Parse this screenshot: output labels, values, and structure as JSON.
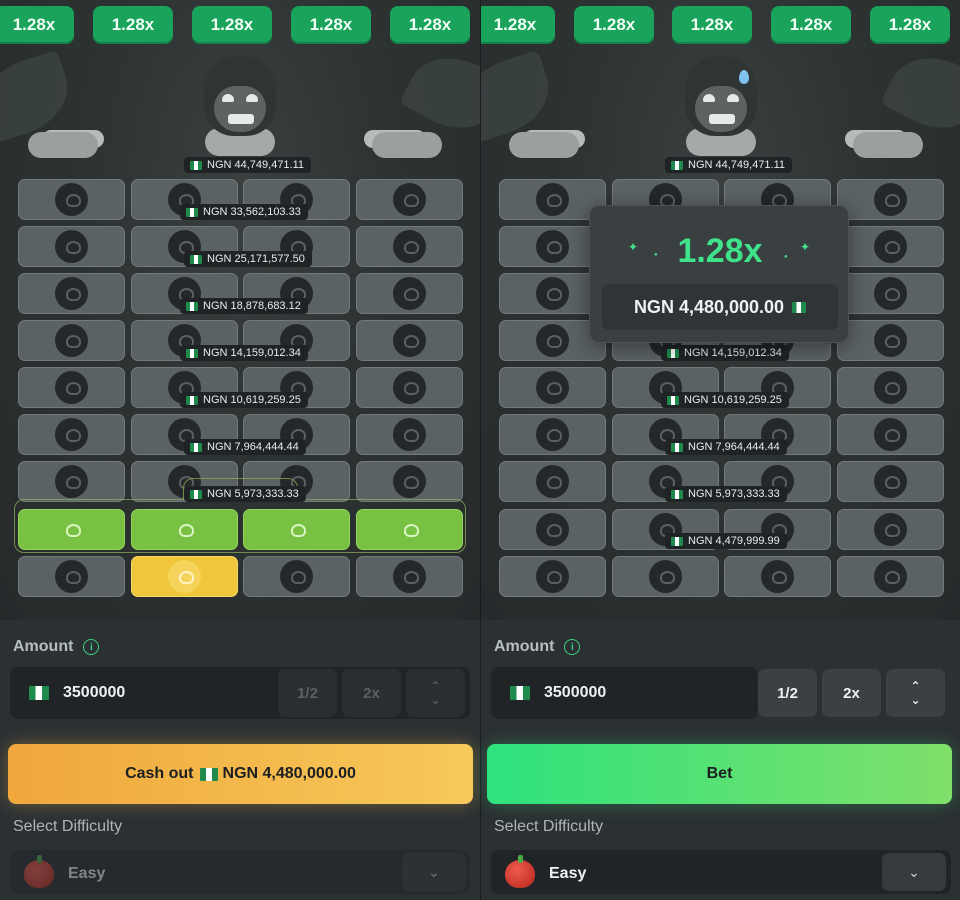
{
  "multiplier_pills": [
    "1.28x",
    "1.28x",
    "1.28x",
    "1.28x",
    "1.28x"
  ],
  "row_payouts_left": [
    "NGN 44,749,471.11",
    "NGN 33,562,103.33",
    "NGN 25,171,577.50",
    "NGN 18,878,683.12",
    "NGN 14,159,012.34",
    "NGN 10,619,259.25",
    "NGN 7,964,444.44",
    "NGN 5,973,333.33"
  ],
  "row_payouts_right": [
    "NGN 44,749,471.11",
    "NGN 14,159,012.34",
    "NGN 10,619,259.25",
    "NGN 7,964,444.44",
    "NGN 5,973,333.33",
    "NGN 4,479,999.99"
  ],
  "win_popup": {
    "multiplier": "1.28x",
    "amount": "NGN 4,480,000.00"
  },
  "left_controls": {
    "amount_label": "Amount",
    "amount_value": "3500000",
    "half_label": "1/2",
    "double_label": "2x",
    "cashout_text": "Cash out",
    "cashout_amount": "NGN 4,480,000.00",
    "difficulty_label": "Select Difficulty",
    "difficulty_value": "Easy"
  },
  "right_controls": {
    "amount_label": "Amount",
    "amount_value": "3500000",
    "half_label": "1/2",
    "double_label": "2x",
    "bet_label": "Bet",
    "difficulty_label": "Select Difficulty",
    "difficulty_value": "Easy"
  },
  "colors": {
    "accent_green": "#1aa35a",
    "win_green": "#3fe38a",
    "cashout_orange": "#f0a73c",
    "apple_red": "#d8352a"
  }
}
